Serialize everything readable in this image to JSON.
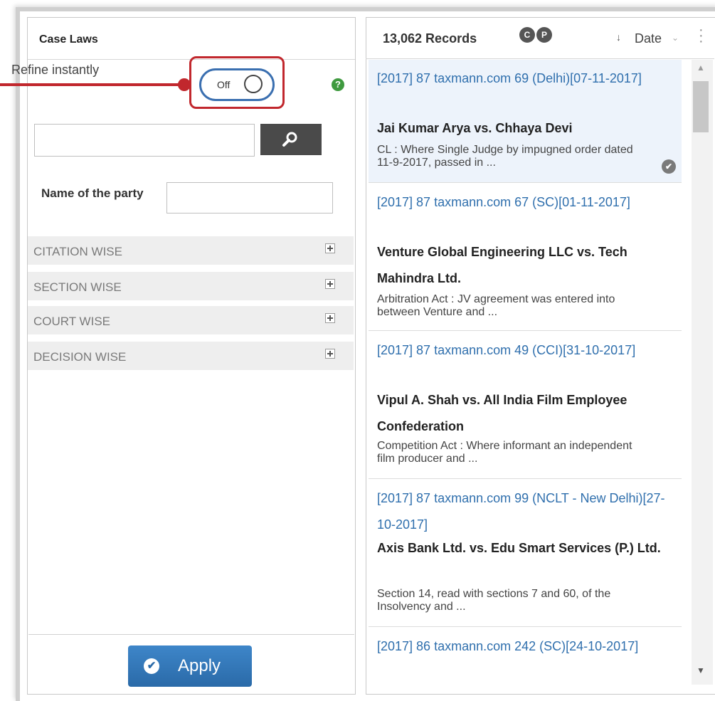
{
  "left_panel": {
    "title": "Case Laws",
    "refine_label": "Refine instantly",
    "toggle_state": "Off",
    "search": {
      "value": "",
      "placeholder": ""
    },
    "party_label": "Name of the party",
    "party_value": "",
    "sections": [
      "CITATION WISE",
      "SECTION WISE",
      "COURT WISE",
      "DECISION WISE"
    ],
    "apply_label": "Apply"
  },
  "right_panel": {
    "record_count": "13,062 Records",
    "icons": {
      "c": "C",
      "p": "P"
    },
    "sort_label": "Date",
    "results": [
      {
        "citation": "[2017] 87 taxmann.com 69 (Delhi)[07-11-2017]",
        "title": "Jai Kumar Arya vs. Chhaya Devi",
        "snippet": "CL : Where Single Judge by impugned order dated 11-9-2017, passed in ..."
      },
      {
        "citation": "[2017] 87 taxmann.com 67 (SC)[01-11-2017]",
        "title": "Venture Global Engineering LLC vs. Tech Mahindra Ltd.",
        "snippet": "Arbitration Act : JV agreement was entered into between Venture and ..."
      },
      {
        "citation": "[2017] 87 taxmann.com 49 (CCI)[31-10-2017]",
        "title": "Vipul A. Shah vs. All India Film Employee Confederation",
        "snippet": "Competition Act : Where informant an independent film producer and ..."
      },
      {
        "citation": "[2017] 87 taxmann.com 99 (NCLT - New Delhi)[27-10-2017]",
        "title": "Axis Bank Ltd. vs. Edu Smart Services (P.) Ltd.",
        "snippet": "Section 14, read with sections 7 and 60, of the Insolvency and ..."
      },
      {
        "citation": "[2017] 86 taxmann.com 242 (SC)[24-10-2017]",
        "title": "",
        "snippet": ""
      }
    ]
  },
  "colors": {
    "accent_blue": "#2f6fad",
    "highlight_red": "#c1272d",
    "help_green": "#3f9a3f"
  }
}
